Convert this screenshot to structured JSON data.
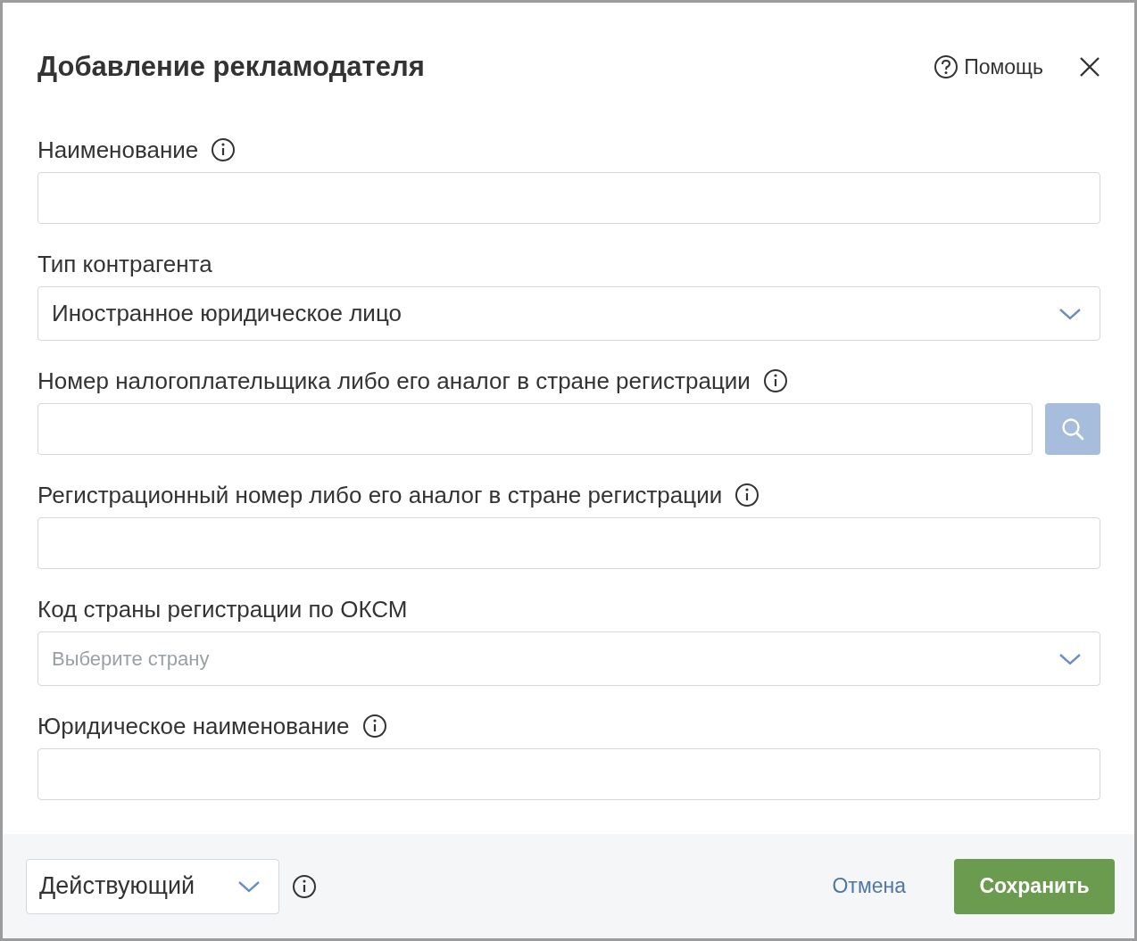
{
  "dialog": {
    "title": "Добавление рекламодателя",
    "help": "Помощь"
  },
  "fields": [
    {
      "kind": "text",
      "label": "Наименование",
      "info": true
    },
    {
      "kind": "select",
      "label": "Тип контрагента",
      "info": false,
      "value": "Иностранное юридическое лицо"
    },
    {
      "kind": "search",
      "label": "Номер налогоплательщика либо его аналог в стране регистрации",
      "info": true
    },
    {
      "kind": "text",
      "label": "Регистрационный номер либо его аналог в стране регистрации",
      "info": true
    },
    {
      "kind": "select",
      "label": "Код страны регистрации по ОКСМ",
      "info": false,
      "placeholder": "Выберите страну"
    },
    {
      "kind": "text",
      "label": "Юридическое наименование",
      "info": true
    }
  ],
  "footer": {
    "status": "Действующий",
    "cancel": "Отмена",
    "save": "Сохранить"
  }
}
